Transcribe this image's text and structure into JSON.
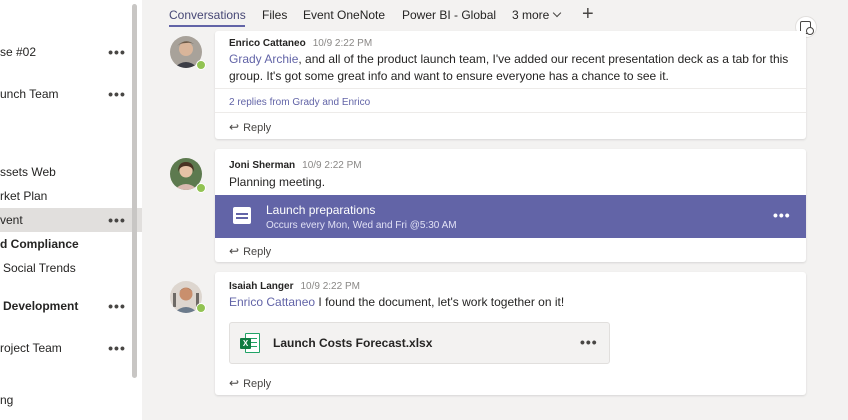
{
  "sidebar": {
    "items": [
      {
        "label": "se #02",
        "more": "•••"
      },
      {
        "label": "unch Team",
        "more": "•••"
      },
      {
        "label": "ssets Web"
      },
      {
        "label": "rket Plan"
      },
      {
        "label": "vent",
        "more": "•••"
      },
      {
        "label": "d Compliance"
      },
      {
        "label": "Social Trends"
      },
      {
        "label": "Development",
        "more": "•••"
      },
      {
        "label": "roject Team",
        "more": "•••"
      },
      {
        "label": "ng"
      }
    ]
  },
  "tabs": {
    "conversations": "Conversations",
    "files": "Files",
    "event_onenote": "Event OneNote",
    "power_bi": "Power BI - Global",
    "more": "3 more",
    "add": "+"
  },
  "posts": [
    {
      "author": "Enrico Cattaneo",
      "timestamp": "10/9 2:22 PM",
      "mention": "Grady Archie",
      "message": ", and all of the product launch team, I've added our recent presentation deck as a tab for this group. It's got some great info and want to ensure everyone has a chance to see it.",
      "replies_summary": "2 replies from Grady and Enrico",
      "reply_label": "Reply",
      "reply_icon": "↩"
    },
    {
      "author": "Joni Sherman",
      "timestamp": "10/9 2:22 PM",
      "message": "Planning meeting.",
      "event": {
        "title": "Launch preparations",
        "subtitle": "Occurs every Mon, Wed and Fri @5:30 AM",
        "more": "•••"
      },
      "reply_label": "Reply",
      "reply_icon": "↩"
    },
    {
      "author": "Isaiah Langer",
      "timestamp": "10/9 2:22 PM",
      "mention": "Enrico Cattaneo",
      "message": " I found the document, let's work together on it!",
      "file": {
        "name": "Launch Costs Forecast.xlsx",
        "badge": "X",
        "more": "•••"
      },
      "reply_label": "Reply",
      "reply_icon": "↩"
    }
  ],
  "colors": {
    "accent": "#6264a7",
    "presence_available": "#92c353",
    "excel_green": "#107c41"
  }
}
